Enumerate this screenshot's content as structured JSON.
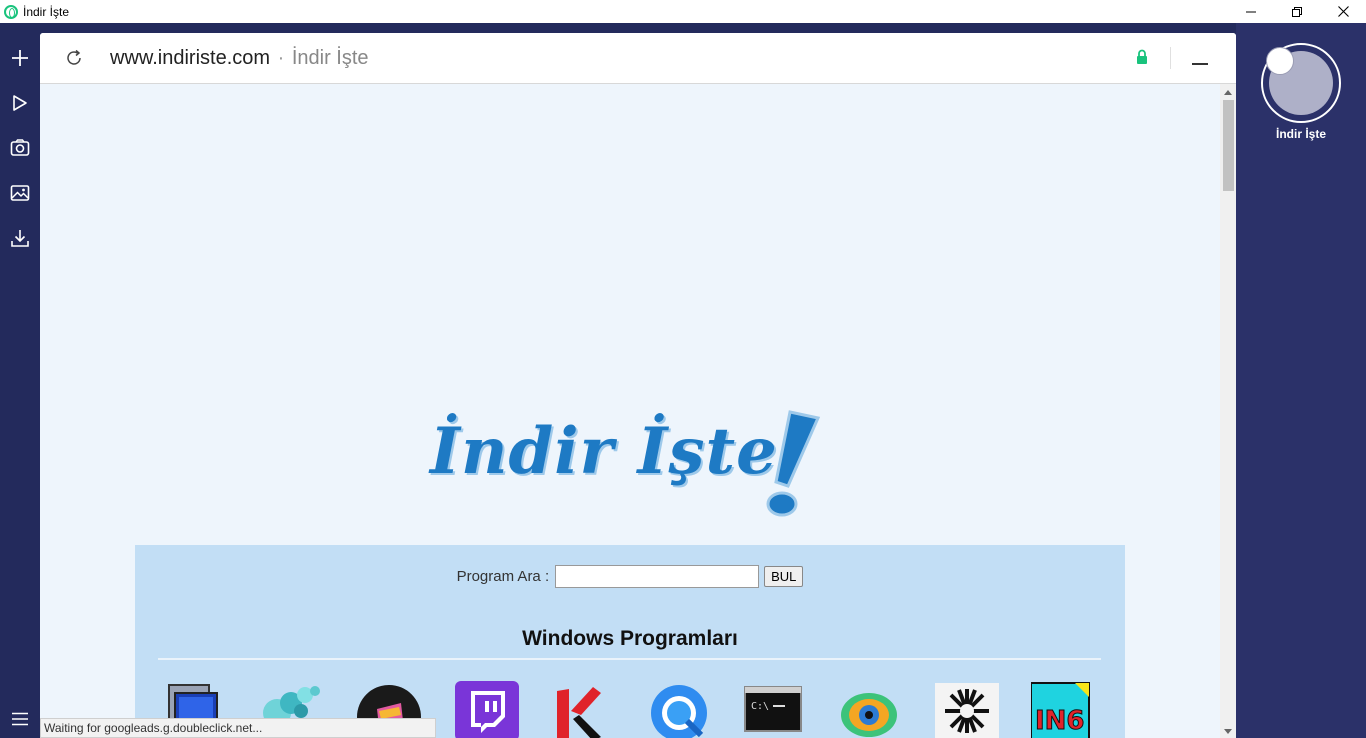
{
  "window": {
    "title": "İndir İşte",
    "controls": {
      "minimize": "minimize-icon",
      "maximize": "restore-icon",
      "close": "close-icon"
    }
  },
  "sidebar": {
    "items": [
      {
        "icon": "plus-icon"
      },
      {
        "icon": "play-icon"
      },
      {
        "icon": "camera-icon"
      },
      {
        "icon": "image-icon"
      },
      {
        "icon": "download-icon"
      }
    ],
    "menu_icon": "hamburger-menu-icon"
  },
  "address_bar": {
    "domain": "www.indiriste.com",
    "separator": "·",
    "page_title": "İndir İşte",
    "secure": true
  },
  "page": {
    "logo_text": "İndir İşte",
    "search": {
      "label": "Program Ara :",
      "value": "",
      "button": "BUL"
    },
    "section_title": "Windows Programları",
    "app_icons": [
      "monitor-app-icon",
      "crystal-app-icon",
      "dark-circle-app-icon",
      "twitch-app-icon",
      "kaspersky-app-icon",
      "quicktime-app-icon",
      "console-app-icon",
      "eye-app-icon",
      "clock-app-icon",
      "in6-app-icon"
    ],
    "in6_text": "IN6",
    "console_text": "C:\\"
  },
  "status_bar": {
    "text": "Waiting for googleads.g.doubleclick.net..."
  },
  "right_panel": {
    "tab_label": "İndir İşte"
  },
  "colors": {
    "frame_bg": "#232a5c",
    "logo_blue": "#1e7ac4",
    "panel_bg": "#c2def5",
    "lock_green": "#19c37d"
  }
}
